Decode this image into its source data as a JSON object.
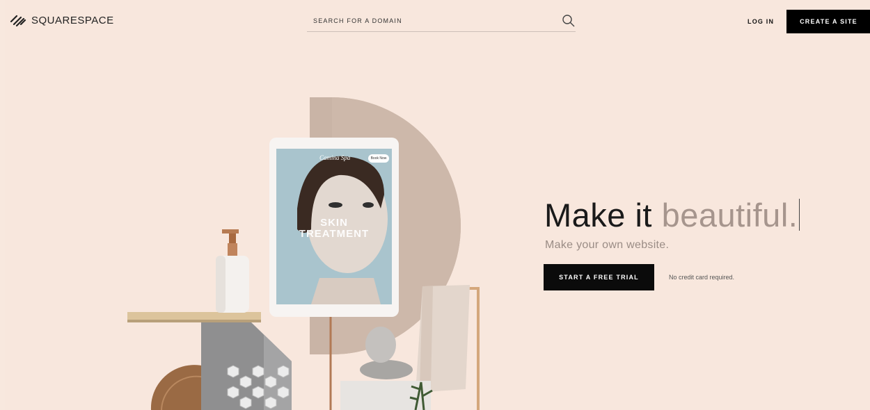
{
  "header": {
    "logo_text": "SQUARESPACE",
    "search_placeholder": "SEARCH FOR A DOMAIN",
    "login_label": "LOG IN",
    "create_label": "CREATE A SITE"
  },
  "hero": {
    "headline_dark": "Make it",
    "headline_light": "beautiful.",
    "subhead": "Make your own website.",
    "cta_label": "START A FREE TRIAL",
    "cta_note": "No credit card required."
  },
  "tablet": {
    "site_name": "Camina Spa",
    "button_label": "Book Now",
    "title_line1": "SKIN",
    "title_line2": "TREATMENT"
  },
  "colors": {
    "background": "#f8e7dd",
    "accent": "#000000",
    "headline_light": "#a6958d"
  },
  "icons": {
    "logo": "squarespace-logo-icon",
    "search": "search-icon"
  }
}
